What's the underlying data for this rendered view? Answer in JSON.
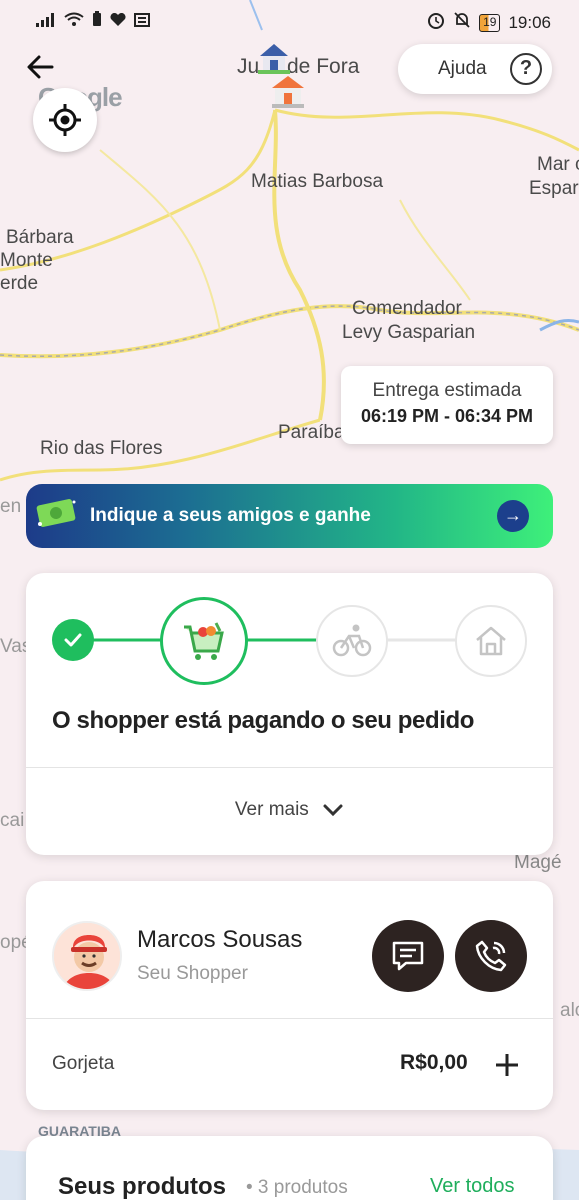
{
  "status_bar": {
    "time": "19:06",
    "battery": "19"
  },
  "map": {
    "labels": [
      "Ju",
      "de Fora",
      "Matias Barbosa",
      "Mar c",
      "Espar",
      "Bárbara",
      "Monte",
      "erde",
      "Comendador",
      "Levy Gasparian",
      "Rio das Flores",
      "Paraíba",
      "Vas",
      "Magé",
      "cai",
      "opé",
      "GUARATIBA",
      "en",
      "alo"
    ],
    "google_logo": "Google"
  },
  "header": {
    "help_label": "Ajuda"
  },
  "eta": {
    "label": "Entrega estimada",
    "window": "06:19 PM - 06:34 PM"
  },
  "promo": {
    "text": "Indique a seus amigos e ganhe"
  },
  "order_status": {
    "title": "O shopper está pagando o seu pedido",
    "see_more": "Ver mais",
    "steps": [
      "confirmed",
      "shopping",
      "delivery",
      "home"
    ]
  },
  "shopper": {
    "name": "Marcos Sousas",
    "role": "Seu Shopper",
    "tip_label": "Gorjeta",
    "tip_value": "R$0,00"
  },
  "products": {
    "title": "Seus produtos",
    "count": "• 3 produtos",
    "see_all": "Ver todos"
  },
  "colors": {
    "accent_green": "#1fbe5e",
    "dark_button": "#2d2321",
    "link_green": "#1fae5c"
  }
}
